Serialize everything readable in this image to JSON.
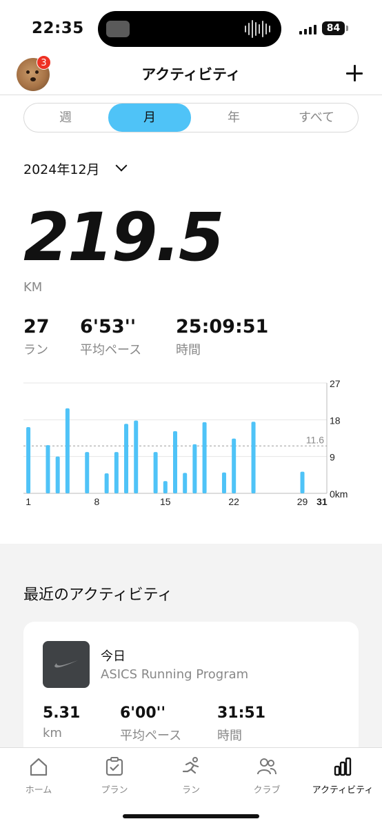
{
  "status_bar": {
    "time": "22:35",
    "battery": "84"
  },
  "header": {
    "title": "アクティビティ",
    "notification_count": "3"
  },
  "segments": [
    {
      "label": "週",
      "active": false
    },
    {
      "label": "月",
      "active": true
    },
    {
      "label": "年",
      "active": false
    },
    {
      "label": "すべて",
      "active": false
    }
  ],
  "period": {
    "label": "2024年12月"
  },
  "summary": {
    "distance": "219.5",
    "distance_unit": "KM",
    "runs_value": "27",
    "runs_label": "ラン",
    "pace_value": "6'53''",
    "pace_label": "平均ペース",
    "time_value": "25:09:51",
    "time_label": "時間"
  },
  "chart_data": {
    "type": "bar",
    "x": [
      1,
      3,
      4,
      5,
      7,
      9,
      10,
      11,
      12,
      14,
      15,
      16,
      17,
      18,
      19,
      21,
      22,
      24,
      29
    ],
    "values": [
      16.2,
      11.8,
      9.0,
      20.8,
      10.1,
      4.9,
      10.1,
      17.0,
      17.8,
      10.1,
      3.0,
      15.2,
      5.0,
      12.0,
      17.4,
      5.1,
      13.4,
      17.5,
      5.3
    ],
    "xticks": [
      "1",
      "8",
      "15",
      "22",
      "29",
      "31"
    ],
    "yticks": [
      "27",
      "18",
      "9",
      "0km"
    ],
    "ylim": [
      0,
      27
    ],
    "average_value": 11.6,
    "average_label": "11.6",
    "color": "#4fc3f7"
  },
  "recent": {
    "title": "最近のアクティビティ",
    "item": {
      "date": "今日",
      "program": "ASICS Running Program",
      "distance_value": "5.31",
      "distance_label": "km",
      "pace_value": "6'00''",
      "pace_label": "平均ペース",
      "time_value": "31:51",
      "time_label": "時間"
    }
  },
  "tabs": [
    {
      "label": "ホーム",
      "icon": "home-icon",
      "active": false
    },
    {
      "label": "プラン",
      "icon": "plan-clipboard-icon",
      "active": false
    },
    {
      "label": "ラン",
      "icon": "runner-icon",
      "active": false
    },
    {
      "label": "クラブ",
      "icon": "club-people-icon",
      "active": false
    },
    {
      "label": "アクティビティ",
      "icon": "activity-bars-icon",
      "active": true
    }
  ]
}
